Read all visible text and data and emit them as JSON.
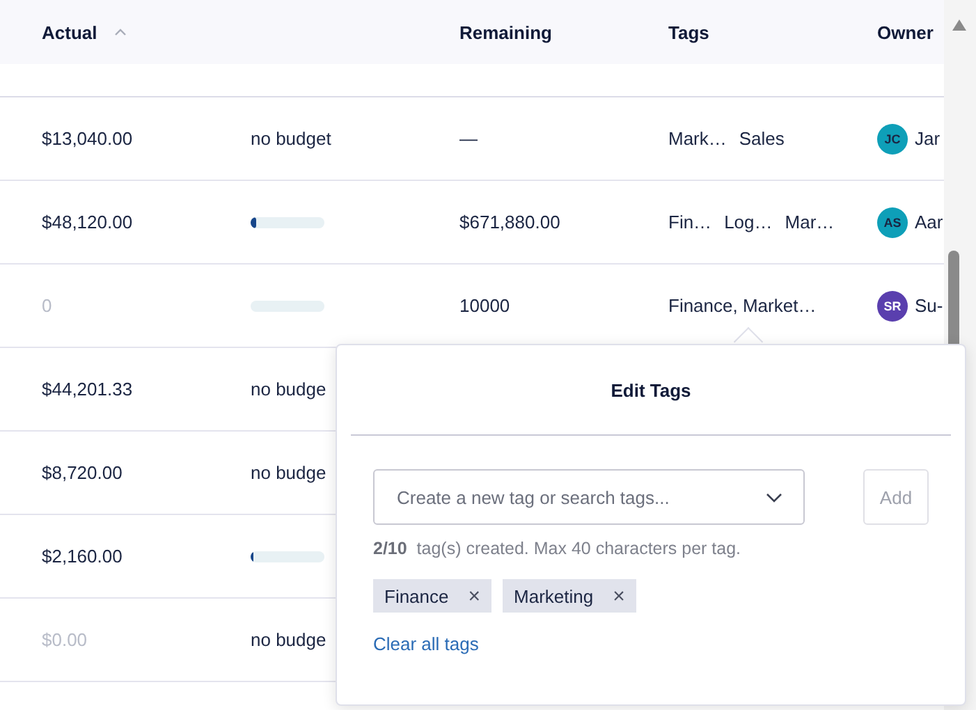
{
  "table": {
    "columns": [
      {
        "label": "Actual",
        "sorted": true
      },
      {
        "label": "Remaining",
        "sorted": false
      },
      {
        "label": "Tags",
        "sorted": false
      },
      {
        "label": "Owner",
        "sorted": false
      }
    ],
    "rows": [
      {
        "actual": "$13,040.00",
        "muted": false,
        "budget": {
          "kind": "text",
          "text": "no budget"
        },
        "remaining": "—",
        "tags": [
          "Mark…",
          "Sales"
        ],
        "owner": {
          "initials": "JC",
          "color": "#0e9fb8",
          "name": "Jar"
        }
      },
      {
        "actual": "$48,120.00",
        "muted": false,
        "budget": {
          "kind": "bar",
          "level": 0.07
        },
        "remaining": "$671,880.00",
        "tags": [
          "Fin…",
          "Log…",
          "Mar…"
        ],
        "owner": {
          "initials": "AS",
          "color": "#0e9fb8",
          "name": "Aar"
        }
      },
      {
        "actual": "0",
        "muted": true,
        "budget": {
          "kind": "bar",
          "level": 0
        },
        "remaining": "10000",
        "tags": [
          "Finance, Market…"
        ],
        "owner": {
          "initials": "SR",
          "color": "#5a3fae",
          "name": "Su-"
        }
      },
      {
        "actual": "$44,201.33",
        "muted": false,
        "budget": {
          "kind": "text",
          "text": "no budge"
        }
      },
      {
        "actual": "$8,720.00",
        "muted": false,
        "budget": {
          "kind": "text",
          "text": "no budge"
        }
      },
      {
        "actual": "$2,160.00",
        "muted": false,
        "budget": {
          "kind": "bar",
          "level": 0.02
        }
      },
      {
        "actual": "$0.00",
        "muted": true,
        "budget": {
          "kind": "text",
          "text": "no budge"
        }
      }
    ]
  },
  "popover": {
    "title": "Edit Tags",
    "search": {
      "placeholder": "Create a new tag or search tags..."
    },
    "add_button": "Add",
    "add_disabled": true,
    "helper": "**2/10**  tag(s) created. Max 40 characters per tag.",
    "tags": [
      {
        "label": "Finance",
        "remove": "×"
      },
      {
        "label": "Marketing",
        "remove": "×"
      }
    ],
    "clear_link": "Clear all tags"
  }
}
